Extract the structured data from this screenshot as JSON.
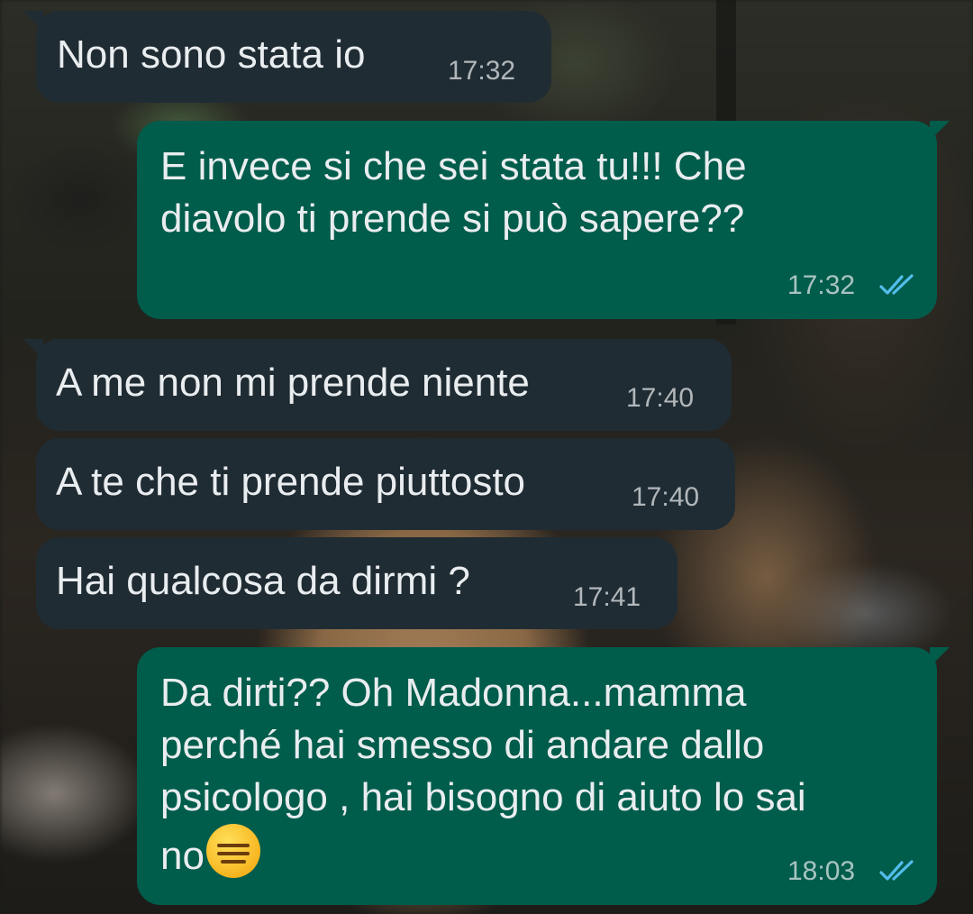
{
  "chat": {
    "messages": [
      {
        "direction": "incoming",
        "text": "Non sono stata io",
        "time": "17:32"
      },
      {
        "direction": "outgoing",
        "lines": [
          "E invece si che sei stata tu!!! Che",
          "diavolo ti prende si può sapere??"
        ],
        "time": "17:32",
        "status_icon": "double-check-read-icon"
      },
      {
        "direction": "incoming",
        "text": "A me non mi prende niente",
        "time": "17:40"
      },
      {
        "direction": "incoming",
        "text": "A te che ti prende piuttosto",
        "time": "17:40"
      },
      {
        "direction": "incoming",
        "text": "Hai qualcosa da dirmi ?",
        "time": "17:41"
      },
      {
        "direction": "outgoing",
        "lines": [
          "Da dirti?? Oh Madonna...mamma",
          "perché hai smesso di andare dallo",
          "psicologo , hai bisogno di aiuto lo sai",
          "no"
        ],
        "emoji": "expressionless-face-emoji",
        "time": "18:03",
        "status_icon": "double-check-read-icon"
      }
    ]
  },
  "colors": {
    "incoming_bubble": "#202c33",
    "outgoing_bubble": "#005c4b",
    "message_text": "#e9edef",
    "read_ticks": "#53bdeb"
  }
}
